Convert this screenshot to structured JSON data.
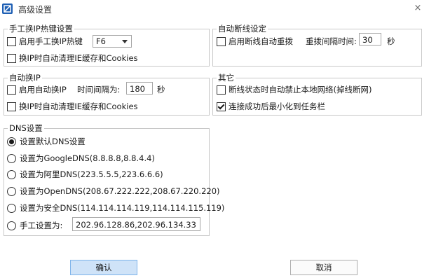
{
  "window": {
    "title": "高级设置",
    "close_symbol": "×"
  },
  "hotkey_group": {
    "legend": "手工换IP热键设置",
    "enable_label": "启用手工换IP热键",
    "enable_checked": false,
    "key_value": "F6",
    "clear_cache_label": "换IP时自动清理IE缓存和Cookies",
    "clear_cache_checked": false
  },
  "disconnect_group": {
    "legend": "自动断线设定",
    "enable_label": "启用断线自动重拨",
    "enable_checked": false,
    "interval_label": "重拨间隔时间:",
    "interval_value": "30",
    "unit": "秒"
  },
  "auto_ip_group": {
    "legend": "自动换IP",
    "enable_label": "启用自动换IP",
    "enable_checked": false,
    "interval_label": "时间间隔为:",
    "interval_value": "180",
    "unit": "秒",
    "clear_cache_label": "换IP时自动清理IE缓存和Cookies",
    "clear_cache_checked": false
  },
  "other_group": {
    "legend": "其它",
    "block_network_label": "断线状态时自动禁止本地网络(掉线断网)",
    "block_network_checked": false,
    "minimize_label": "连接成功后最小化到任务栏",
    "minimize_checked": true
  },
  "dns_group": {
    "legend": "DNS设置",
    "selected": 0,
    "options": [
      {
        "label": "设置默认DNS设置"
      },
      {
        "label": "设置为GoogleDNS(8.8.8.8,8.8.4.4)"
      },
      {
        "label": "设置为阿里DNS(223.5.5.5,223.6.6.6)"
      },
      {
        "label": "设置为OpenDNS(208.67.222.222,208.67.220.220)"
      },
      {
        "label": "设置为安全DNS(114.114.114.119,114.114.115.119)"
      },
      {
        "label": "手工设置为:"
      }
    ],
    "manual_value": "202.96.128.86,202.96.134.33"
  },
  "buttons": {
    "ok": "确认",
    "cancel": "取消"
  },
  "colors": {
    "ok_bg": "#cfe3f8",
    "ok_border": "#7eb4ea",
    "icon_blue": "#1e5fb4"
  }
}
